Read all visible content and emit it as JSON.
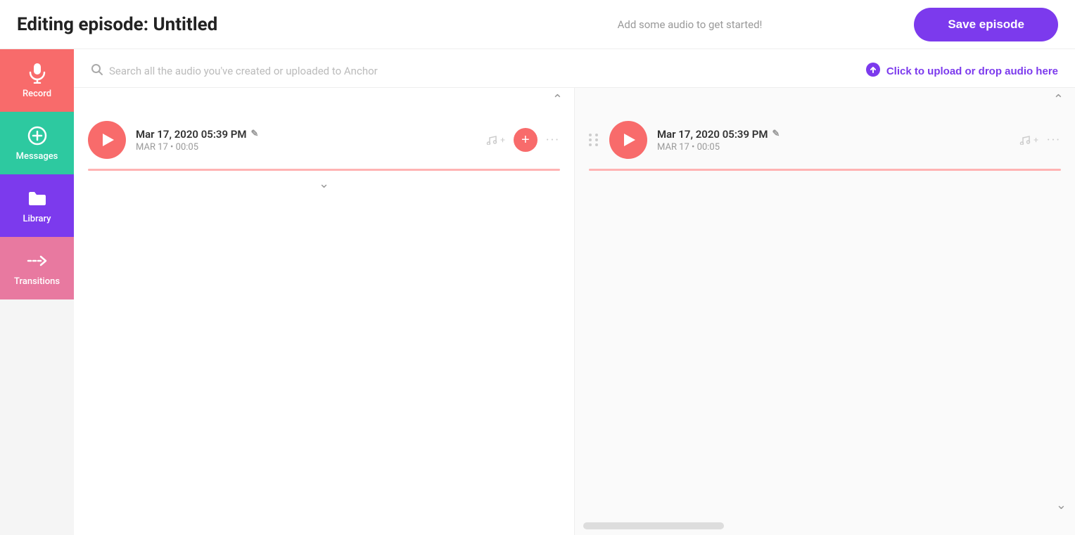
{
  "header": {
    "title": "Editing episode: Untitled",
    "subtitle": "Add some audio to get started!",
    "save_label": "Save episode"
  },
  "sidebar": {
    "items": [
      {
        "id": "record",
        "label": "Record",
        "icon": "mic",
        "color": "#f86b6b"
      },
      {
        "id": "messages",
        "label": "Messages",
        "icon": "plus-circle",
        "color": "#2dc9a0"
      },
      {
        "id": "library",
        "label": "Library",
        "icon": "folder",
        "color": "#7c3aed"
      },
      {
        "id": "transitions",
        "label": "Transitions",
        "icon": "arrow-right-dashed",
        "color": "#e879a0"
      }
    ]
  },
  "search": {
    "placeholder": "Search all the audio you've created or uploaded to Anchor"
  },
  "upload": {
    "label": "Click to upload or drop audio here"
  },
  "audio_card": {
    "title": "Mar 17, 2020 05:39 PM",
    "date": "MAR 17",
    "duration": "00:05",
    "edit_icon": "✎"
  },
  "episode_card": {
    "title": "Mar 17, 2020 05:39 PM",
    "date": "MAR 17",
    "duration": "00:05",
    "edit_icon": "✎"
  }
}
